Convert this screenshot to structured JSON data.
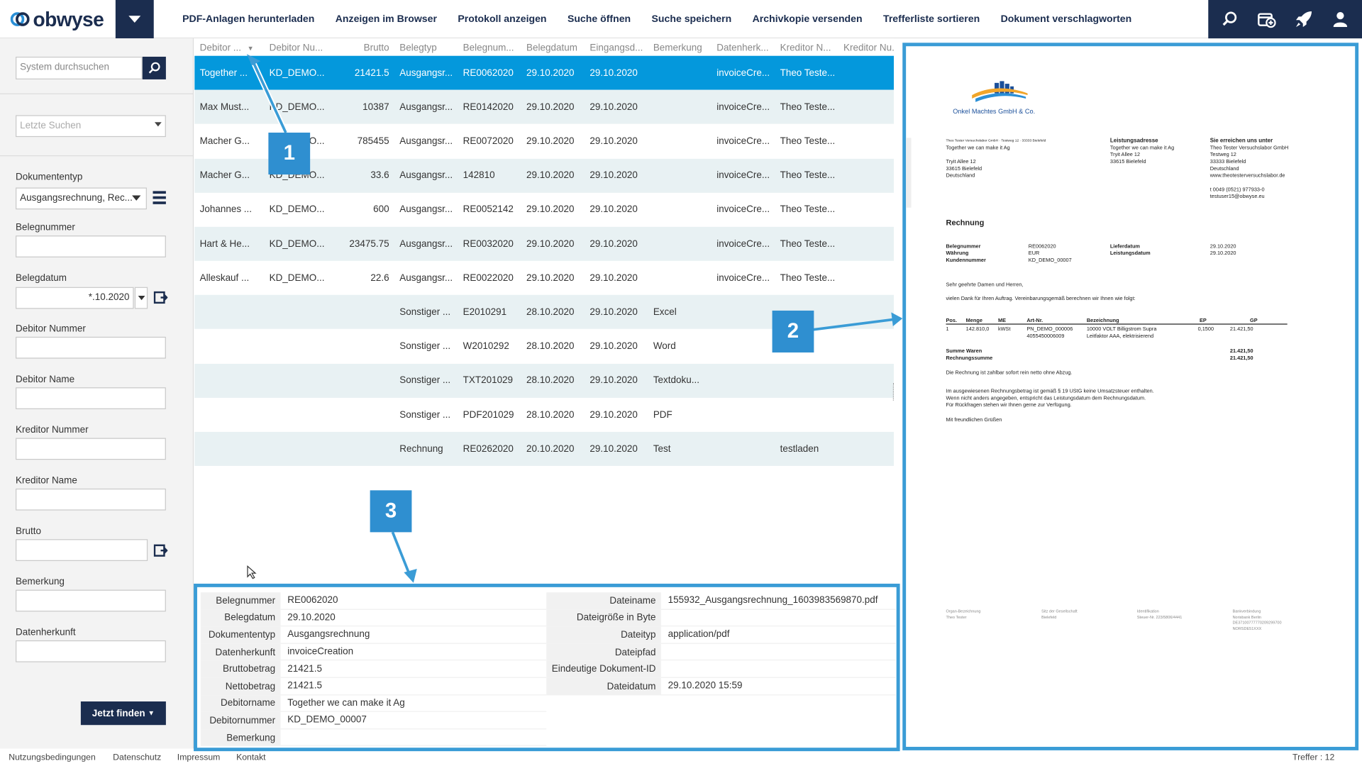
{
  "header": {
    "logo_text": "obwyse",
    "menu": [
      "PDF-Anlagen herunterladen",
      "Anzeigen im Browser",
      "Protokoll anzeigen",
      "Suche öffnen",
      "Suche speichern",
      "Archivkopie versenden",
      "Trefferliste sortieren",
      "Dokument verschlagworten"
    ],
    "right_icons": [
      "search-icon",
      "calendar-add-icon",
      "rocket-icon",
      "user-icon"
    ]
  },
  "sidebar": {
    "search_placeholder": "System durchsuchen",
    "recent_placeholder": "Letzte Suchen",
    "fields": [
      {
        "label": "Dokumententyp",
        "value": "Ausgangsrechnung, Rec..."
      },
      {
        "label": "Belegnummer",
        "value": ""
      },
      {
        "label": "Belegdatum",
        "value": "*.10.2020"
      },
      {
        "label": "Debitor Nummer",
        "value": ""
      },
      {
        "label": "Debitor Name",
        "value": ""
      },
      {
        "label": "Kreditor Nummer",
        "value": ""
      },
      {
        "label": "Kreditor Name",
        "value": ""
      },
      {
        "label": "Brutto",
        "value": ""
      },
      {
        "label": "Bemerkung",
        "value": ""
      },
      {
        "label": "Datenherkunft",
        "value": ""
      }
    ],
    "find_button": "Jetzt finden"
  },
  "table": {
    "columns": [
      "Debitor ...",
      "Debitor Nu...",
      "Brutto",
      "Belegtyp",
      "Belegnum...",
      "Belegdatum",
      "Eingangsd...",
      "Bemerkung",
      "Datenherk...",
      "Kreditor N...",
      "Kreditor Nu..."
    ],
    "rows": [
      [
        "Together ...",
        "KD_DEMO...",
        "21421.5",
        "Ausgangsr...",
        "RE0062020",
        "29.10.2020",
        "29.10.2020",
        "",
        "invoiceCre...",
        "Theo Teste...",
        ""
      ],
      [
        "Max Must...",
        "KD_DEMO...",
        "10387",
        "Ausgangsr...",
        "RE0142020",
        "29.10.2020",
        "29.10.2020",
        "",
        "invoiceCre...",
        "Theo Teste...",
        ""
      ],
      [
        "Macher G...",
        "KD_DEMO...",
        "785455",
        "Ausgangsr...",
        "RE0072020",
        "29.10.2020",
        "29.10.2020",
        "",
        "invoiceCre...",
        "Theo Teste...",
        ""
      ],
      [
        "Macher G...",
        "KD_DEMO...",
        "33.6",
        "Ausgangsr...",
        "142810",
        "29.10.2020",
        "29.10.2020",
        "",
        "invoiceCre...",
        "Theo Teste...",
        ""
      ],
      [
        "Johannes ...",
        "KD_DEMO...",
        "600",
        "Ausgangsr...",
        "RE0052142",
        "29.10.2020",
        "29.10.2020",
        "",
        "invoiceCre...",
        "Theo Teste...",
        ""
      ],
      [
        "Hart & He...",
        "KD_DEMO...",
        "23475.75",
        "Ausgangsr...",
        "RE0032020",
        "29.10.2020",
        "29.10.2020",
        "",
        "invoiceCre...",
        "Theo Teste...",
        ""
      ],
      [
        "Alleskauf ...",
        "KD_DEMO...",
        "22.6",
        "Ausgangsr...",
        "RE0022020",
        "29.10.2020",
        "29.10.2020",
        "",
        "invoiceCre...",
        "Theo Teste...",
        ""
      ],
      [
        "",
        "",
        "",
        "Sonstiger ...",
        "E2010291",
        "28.10.2020",
        "29.10.2020",
        "Excel",
        "",
        "",
        ""
      ],
      [
        "",
        "",
        "",
        "Sonstiger ...",
        "W2010292",
        "28.10.2020",
        "29.10.2020",
        "Word",
        "",
        "",
        ""
      ],
      [
        "",
        "",
        "",
        "Sonstiger ...",
        "TXT201029",
        "28.10.2020",
        "29.10.2020",
        "Textdoku...",
        "",
        "",
        ""
      ],
      [
        "",
        "",
        "",
        "Sonstiger ...",
        "PDF201029",
        "28.10.2020",
        "29.10.2020",
        "PDF",
        "",
        "",
        ""
      ],
      [
        "",
        "",
        "",
        "Rechnung",
        "RE0262020",
        "20.10.2020",
        "29.10.2020",
        "Test",
        "",
        "testladen",
        ""
      ]
    ]
  },
  "details": {
    "left": [
      [
        "Belegnummer",
        "RE0062020"
      ],
      [
        "Belegdatum",
        "29.10.2020"
      ],
      [
        "Dokumententyp",
        "Ausgangsrechnung"
      ],
      [
        "Datenherkunft",
        "invoiceCreation"
      ],
      [
        "Bruttobetrag",
        "21421.5"
      ],
      [
        "Nettobetrag",
        "21421.5"
      ],
      [
        "Debitorname",
        "Together we can make it Ag"
      ],
      [
        "Debitornummer",
        "KD_DEMO_00007"
      ],
      [
        "Bemerkung",
        ""
      ]
    ],
    "right": [
      [
        "Dateiname",
        "155932_Ausgangsrechnung_1603983569870.pdf"
      ],
      [
        "Dateigröße in Byte",
        ""
      ],
      [
        "Dateityp",
        "application/pdf"
      ],
      [
        "Dateipfad",
        ""
      ],
      [
        "Eindeutige Dokument-ID",
        ""
      ],
      [
        "Dateidatum",
        "29.10.2020 15:59"
      ]
    ]
  },
  "preview": {
    "company": "Onkel Machtes GmbH & Co.",
    "sender_line": "Theo Tester Versuchslabor GmbH · Testweg 12 · 33333 Bielefeld",
    "recipient": [
      "Together we can make it Ag",
      "",
      "Tryit Allee 12",
      "33615 Bielefeld",
      "Deutschland"
    ],
    "service_title": "Leistungsadresse",
    "service": [
      "Together we can make it Ag",
      "Tryit Allee 12",
      "33615 Bielefeld"
    ],
    "contact_title": "Sie erreichen uns unter",
    "contact": [
      "Theo Tester Versuchslabor GmbH",
      "Testweg 12",
      "33333 Bielefeld",
      "Deutschland",
      "www.theotesterversuchslabor.de",
      "",
      "t  0049 (0521) 977933-0",
      "testuser15@obwyse.eu"
    ],
    "doc_title": "Rechnung",
    "meta_left": [
      [
        "Belegnummer",
        "RE0062020"
      ],
      [
        "Währung",
        "EUR"
      ],
      [
        "Kundennummer",
        "KD_DEMO_00007"
      ]
    ],
    "meta_right": [
      [
        "Lieferdatum",
        "29.10.2020"
      ],
      [
        "Leistungsdatum",
        "29.10.2020"
      ]
    ],
    "greeting": "Sehr geehrte Damen und Herren,",
    "intro": "vielen Dank für Ihren Auftrag. Vereinbarungsgemäß berechnen wir Ihnen wie folgt:",
    "item_headers": [
      "Pos.",
      "Menge",
      "ME",
      "Art-Nr.",
      "Bezeichnung",
      "EP",
      "GP"
    ],
    "item": [
      "1",
      "142.810,0",
      "kWSt",
      "PN_DEMO_000006",
      "10000 VOLT Billigstrom Supra",
      "0,1500",
      "21.421,50"
    ],
    "item2": [
      "4055450006009",
      "Leitfaktor AAA, elektrisierend"
    ],
    "sum_label": "Summe Waren",
    "sum_value": "21.421,50",
    "total_label": "Rechnungssumme",
    "total_value": "21.421,50",
    "note1": "Die Rechnung ist zahlbar sofort rein netto ohne Abzug.",
    "note2": "Im ausgewiesenen Rechnungsbetrag ist gemäß § 19 UStG keine Umsatzsteuer enthalten.",
    "note3": "Wenn nicht anders angegeben, entspricht das Leistungsdatum dem Rechnungsdatum.",
    "note4": "Für Rückfragen stehen wir Ihnen gerne zur Verfügung.",
    "closing": "Mit freundlichen Grüßen",
    "footer": [
      [
        "Organ-Bezeichnung",
        "Theo Tester"
      ],
      [
        "Sitz der Gesellschaft",
        "Bielefeld"
      ],
      [
        "Identifikation",
        "Steuer-Nr. 223/5806/4441"
      ],
      [
        "Bankverbindung",
        "Norisbank Berlin",
        "DE37100777770209299700",
        "NORSDE51XXX"
      ]
    ]
  },
  "badges": [
    "1",
    "2",
    "3"
  ],
  "footer": {
    "links": [
      "Nutzungsbedingungen",
      "Datenschutz",
      "Impressum",
      "Kontakt"
    ],
    "hits": "Treffer : 12"
  },
  "colors": {
    "navy": "#1b2d4f",
    "select": "#0498dc",
    "callout": "#3a9cd6"
  }
}
